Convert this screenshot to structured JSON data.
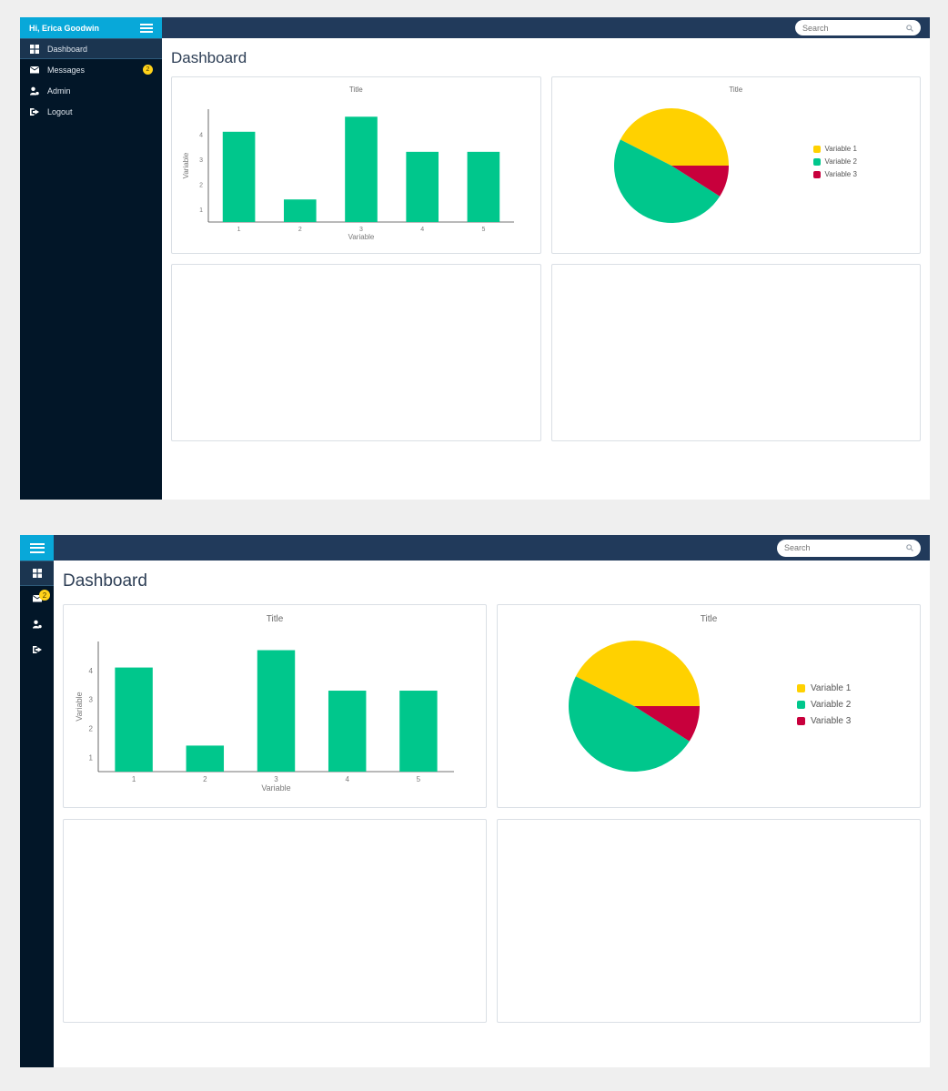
{
  "user": {
    "greeting": "Hi, Erica Goodwin"
  },
  "nav": [
    {
      "label": "Dashboard",
      "icon": "dashboard-icon",
      "active": true
    },
    {
      "label": "Messages",
      "icon": "envelope-icon",
      "badge": "2"
    },
    {
      "label": "Admin",
      "icon": "user-cog-icon"
    },
    {
      "label": "Logout",
      "icon": "sign-out-icon"
    }
  ],
  "search": {
    "placeholder": "Search"
  },
  "page": {
    "title": "Dashboard"
  },
  "colors": {
    "sidebar": "#021628",
    "topbar": "#213a5b",
    "accent": "#08a8d9",
    "badge": "#ffd21a",
    "bar": "#00c78c",
    "variable_1": "#ffd100",
    "variable_2": "#00c78c",
    "variable_3": "#c8003c"
  },
  "chart_data": [
    {
      "type": "bar",
      "title": "Title",
      "categories": [
        "1",
        "2",
        "3",
        "4",
        "5"
      ],
      "values": [
        4.1,
        1.4,
        4.7,
        3.3,
        3.3
      ],
      "xlabel": "Variable",
      "ylabel": "Variable",
      "yticks": [
        1,
        2,
        3,
        4
      ],
      "ylim": [
        0.5,
        5.0
      ],
      "grid": false,
      "legend": "none"
    },
    {
      "type": "pie",
      "title": "Title",
      "labels": [
        "Variable 1",
        "Variable 2",
        "Variable 3"
      ],
      "values": [
        42.5,
        48.5,
        9.0
      ],
      "legend": "right"
    }
  ]
}
